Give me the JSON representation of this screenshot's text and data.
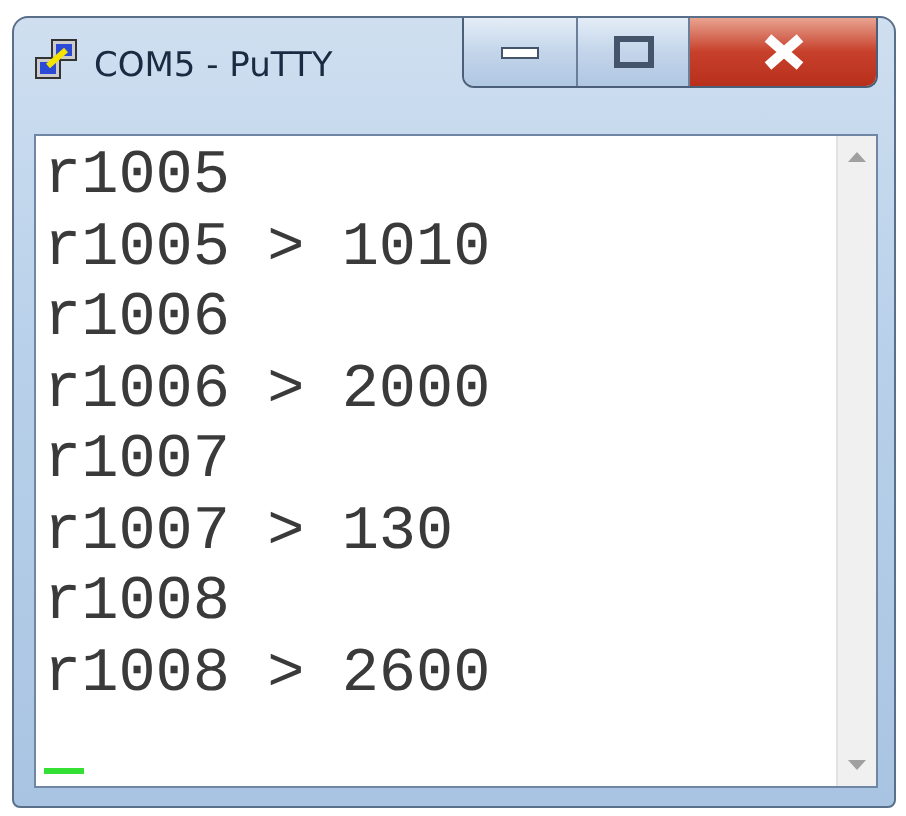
{
  "window": {
    "title": "COM5 - PuTTY"
  },
  "terminal": {
    "lines": [
      "r1005",
      "r1005 > 1010",
      "r1006",
      "r1006 > 2000",
      "r1007",
      "r1007 > 130",
      "r1008",
      "r1008 > 2600"
    ],
    "cursor": true
  }
}
